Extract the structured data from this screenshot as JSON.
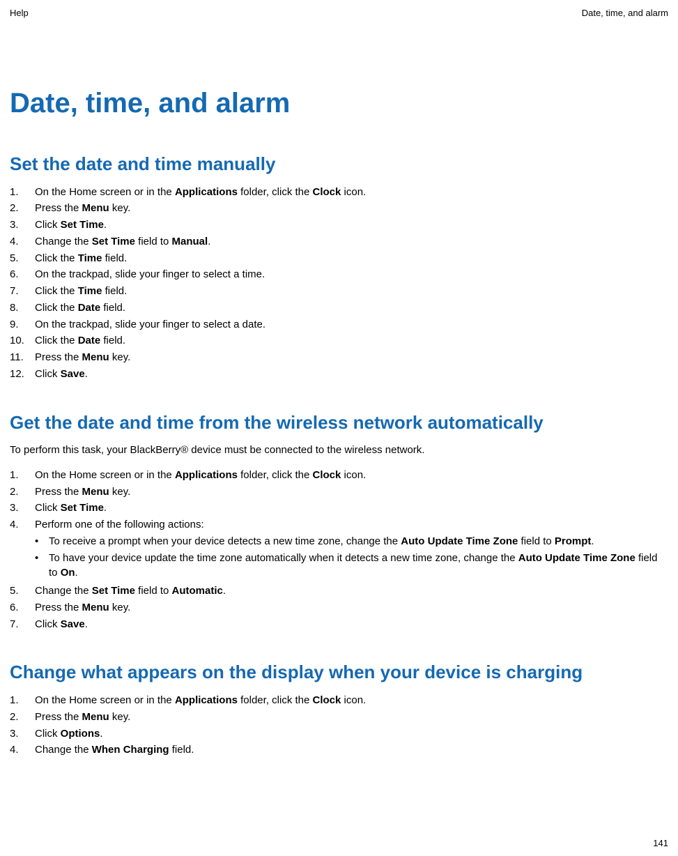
{
  "header": {
    "left": "Help",
    "right": "Date, time, and alarm"
  },
  "title_main": "Date, time, and alarm",
  "section1": {
    "heading": "Set the date and time manually",
    "steps": [
      {
        "num": "1.",
        "segs": [
          "On the Home screen or in the ",
          {
            "b": "Applications"
          },
          " folder, click the ",
          {
            "b": "Clock"
          },
          " icon."
        ]
      },
      {
        "num": "2.",
        "segs": [
          "Press the ",
          {
            "b": "Menu"
          },
          " key."
        ]
      },
      {
        "num": "3.",
        "segs": [
          "Click ",
          {
            "b": "Set Time"
          },
          "."
        ]
      },
      {
        "num": "4.",
        "segs": [
          "Change the ",
          {
            "b": "Set Time"
          },
          " field to ",
          {
            "b": "Manual"
          },
          "."
        ]
      },
      {
        "num": "5.",
        "segs": [
          "Click the ",
          {
            "b": "Time"
          },
          " field."
        ]
      },
      {
        "num": "6.",
        "segs": [
          "On the trackpad, slide your finger to select a time."
        ]
      },
      {
        "num": "7.",
        "segs": [
          "Click the ",
          {
            "b": "Time"
          },
          " field."
        ]
      },
      {
        "num": "8.",
        "segs": [
          "Click the ",
          {
            "b": "Date"
          },
          " field."
        ]
      },
      {
        "num": "9.",
        "segs": [
          "On the trackpad, slide your finger to select a date."
        ]
      },
      {
        "num": "10.",
        "segs": [
          "Click the ",
          {
            "b": "Date"
          },
          " field."
        ]
      },
      {
        "num": "11.",
        "segs": [
          "Press the ",
          {
            "b": "Menu"
          },
          " key."
        ]
      },
      {
        "num": "12.",
        "segs": [
          "Click ",
          {
            "b": "Save"
          },
          "."
        ]
      }
    ]
  },
  "section2": {
    "heading": "Get the date and time from the wireless network automatically",
    "lead": "To perform this task, your BlackBerry® device must be connected to the wireless network.",
    "steps": [
      {
        "num": "1.",
        "segs": [
          "On the Home screen or in the ",
          {
            "b": "Applications"
          },
          " folder, click the ",
          {
            "b": "Clock"
          },
          " icon."
        ]
      },
      {
        "num": "2.",
        "segs": [
          "Press the ",
          {
            "b": "Menu"
          },
          " key."
        ]
      },
      {
        "num": "3.",
        "segs": [
          "Click ",
          {
            "b": "Set Time"
          },
          "."
        ]
      },
      {
        "num": "4.",
        "segs": [
          "Perform one of the following actions:"
        ],
        "bullets": [
          {
            "segs": [
              "To receive a prompt when your device detects a new time zone, change the ",
              {
                "b": "Auto Update Time Zone"
              },
              " field to ",
              {
                "b": "Prompt"
              },
              "."
            ]
          },
          {
            "segs": [
              "To have your device update the time zone automatically when it detects a new time zone, change the ",
              {
                "b": "Auto Update Time Zone"
              },
              " field to ",
              {
                "b": "On"
              },
              "."
            ]
          }
        ]
      },
      {
        "num": "5.",
        "segs": [
          "Change the ",
          {
            "b": "Set Time"
          },
          " field to ",
          {
            "b": "Automatic"
          },
          "."
        ]
      },
      {
        "num": "6.",
        "segs": [
          "Press the ",
          {
            "b": "Menu"
          },
          " key."
        ]
      },
      {
        "num": "7.",
        "segs": [
          "Click ",
          {
            "b": "Save"
          },
          "."
        ]
      }
    ]
  },
  "section3": {
    "heading": "Change what appears on the display when your device is charging",
    "steps": [
      {
        "num": "1.",
        "segs": [
          "On the Home screen or in the ",
          {
            "b": "Applications"
          },
          " folder, click the ",
          {
            "b": "Clock"
          },
          " icon."
        ]
      },
      {
        "num": "2.",
        "segs": [
          "Press the ",
          {
            "b": "Menu"
          },
          " key."
        ]
      },
      {
        "num": "3.",
        "segs": [
          "Click ",
          {
            "b": "Options"
          },
          "."
        ]
      },
      {
        "num": "4.",
        "segs": [
          "Change the ",
          {
            "b": "When Charging"
          },
          " field."
        ]
      }
    ]
  },
  "page_number": "141"
}
